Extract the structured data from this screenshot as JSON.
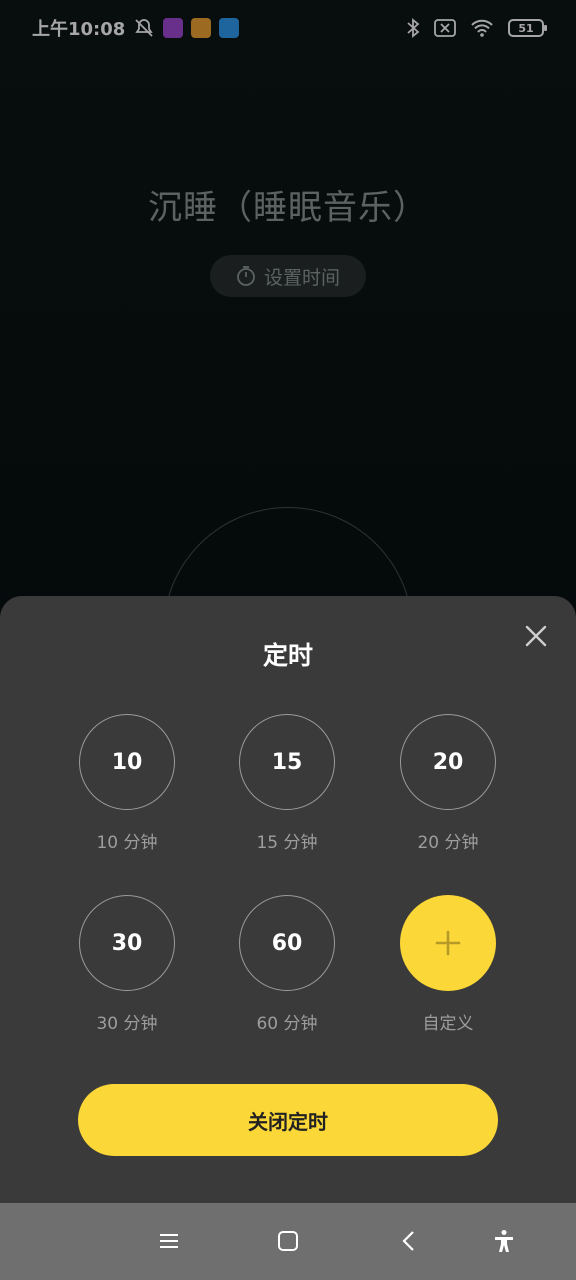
{
  "status_bar": {
    "time": "上午10:08",
    "battery": "51",
    "icons": [
      "mute-notification-icon",
      "app-chart-icon",
      "app-circle-icon",
      "app-arrow-icon",
      "bluetooth-icon",
      "sim-off-icon",
      "wifi-icon",
      "battery-icon"
    ]
  },
  "background": {
    "title": "沉睡（睡眠音乐）",
    "set_time_label": "设置时间"
  },
  "sheet": {
    "title": "定时",
    "options": [
      {
        "value": "10",
        "label": "10 分钟"
      },
      {
        "value": "15",
        "label": "15 分钟"
      },
      {
        "value": "20",
        "label": "20 分钟"
      },
      {
        "value": "30",
        "label": "30 分钟"
      },
      {
        "value": "60",
        "label": "60 分钟"
      }
    ],
    "custom_label": "自定义",
    "close_timer_label": "关闭定时"
  },
  "colors": {
    "accent": "#fbd737",
    "sheet_bg": "#3a3a3a",
    "nav_bg": "#6f6f6f"
  }
}
